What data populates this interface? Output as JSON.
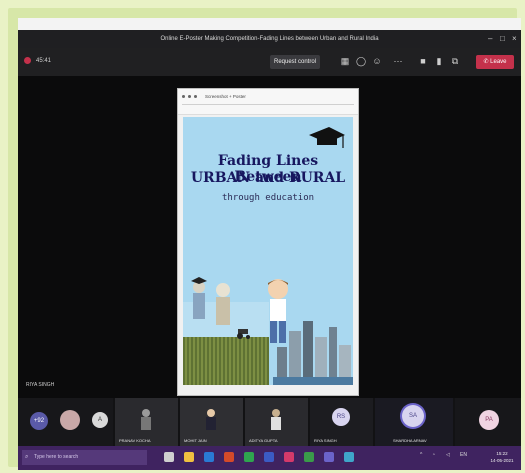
{
  "window": {
    "title": "Online E-Poster Making Competition-Fading Lines between Urban and Rural India",
    "minimize": "–",
    "maximize": "□",
    "close": "×"
  },
  "toolbar": {
    "timer": "45:41",
    "request_control_label": "Request control",
    "leave_label": "Leave"
  },
  "shared_app": {
    "title": "Screenshot + Poster"
  },
  "poster": {
    "title_line1": "Fading Lines Between",
    "title_line2": "URBAN and RURAL",
    "subtitle": "through education"
  },
  "presenter_label": "RIYA SINGH",
  "participants": [
    {
      "label": "+92"
    },
    {
      "label": ""
    },
    {
      "label": "A"
    },
    {
      "label": "PRANAV KOCHA"
    },
    {
      "label": "MOHIT JAIN"
    },
    {
      "label": "ADITYA GUPTA"
    },
    {
      "label": "RS",
      "name": "RIYA SINGH"
    },
    {
      "label": "SA",
      "name": "SHARDHA ARNAV"
    },
    {
      "label": "PA"
    }
  ],
  "taskbar": {
    "search_placeholder": "Type here to search",
    "time": "15:22",
    "date": "14-05-2021"
  },
  "colors": {
    "leave": "#c4314b",
    "taskbar": "#3f2360",
    "poster_bg": "#a9d8f0",
    "poster_text": "#17175f"
  }
}
